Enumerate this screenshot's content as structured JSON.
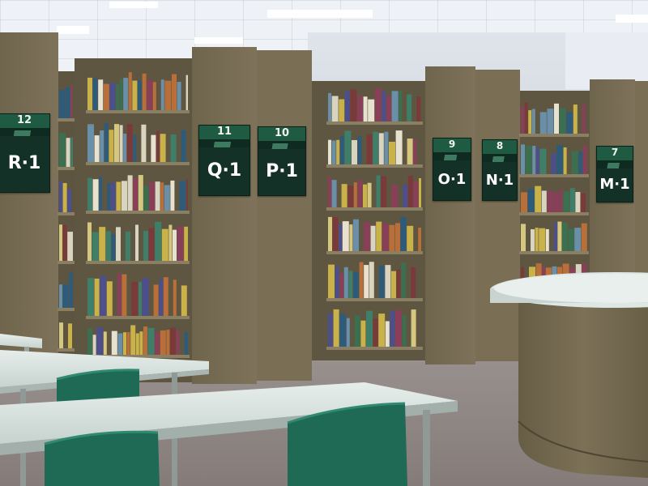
{
  "stack_signs": [
    {
      "number": "12",
      "code": "R·1"
    },
    {
      "number": "11",
      "code": "Q·1"
    },
    {
      "number": "10",
      "code": "P·1"
    },
    {
      "number": "9",
      "code": "O·1"
    },
    {
      "number": "8",
      "code": "N·1"
    },
    {
      "number": "7",
      "code": "M·1"
    }
  ],
  "colors": {
    "shelf_body": "#7a6f55",
    "shelf_side": "#857a5f",
    "sign_bg": "#143127",
    "chair": "#1f6a55",
    "table_top": "#d8e2de",
    "carpet": "#8f8a86",
    "ceiling": "#e8ecf1"
  },
  "objects": [
    "ceiling",
    "ceiling-lights",
    "book-stacks",
    "reading-tables",
    "green-chairs",
    "service-counter",
    "carpet"
  ]
}
